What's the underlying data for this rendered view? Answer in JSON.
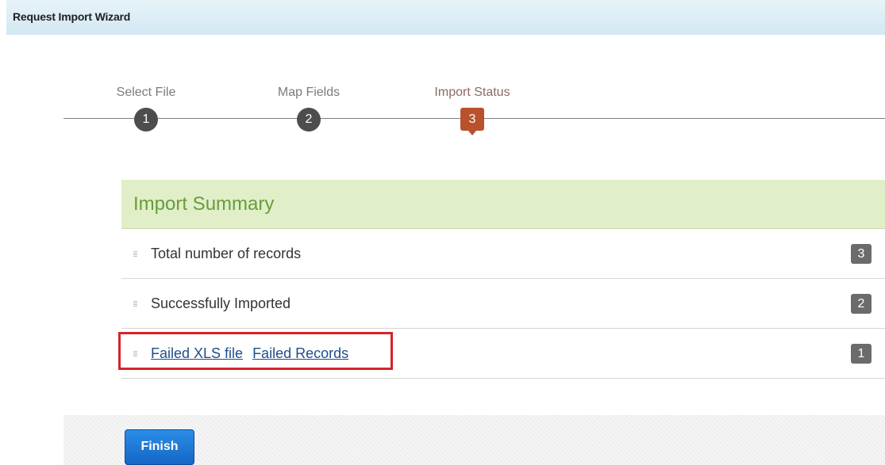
{
  "window": {
    "title": "Request Import Wizard"
  },
  "wizard": {
    "steps": [
      {
        "label": "Select File",
        "number": "1",
        "active": false
      },
      {
        "label": "Map Fields",
        "number": "2",
        "active": false
      },
      {
        "label": "Import Status",
        "number": "3",
        "active": true
      }
    ]
  },
  "summary": {
    "title": "Import Summary",
    "rows": [
      {
        "label": "Total number of records",
        "count": "3"
      },
      {
        "label": "Successfully Imported",
        "count": "2"
      },
      {
        "links": [
          "Failed XLS file",
          "Failed Records"
        ],
        "count": "1"
      }
    ]
  },
  "footer": {
    "finish_label": "Finish"
  },
  "colors": {
    "active_step": "#b8522d",
    "summary_header_bg": "#e0efc7",
    "summary_title": "#6a9b3e",
    "highlight": "#d4242a",
    "link": "#1f4e8c",
    "button": "#1566c7"
  },
  "icons": {
    "bullet": "row-bullet-icon"
  }
}
